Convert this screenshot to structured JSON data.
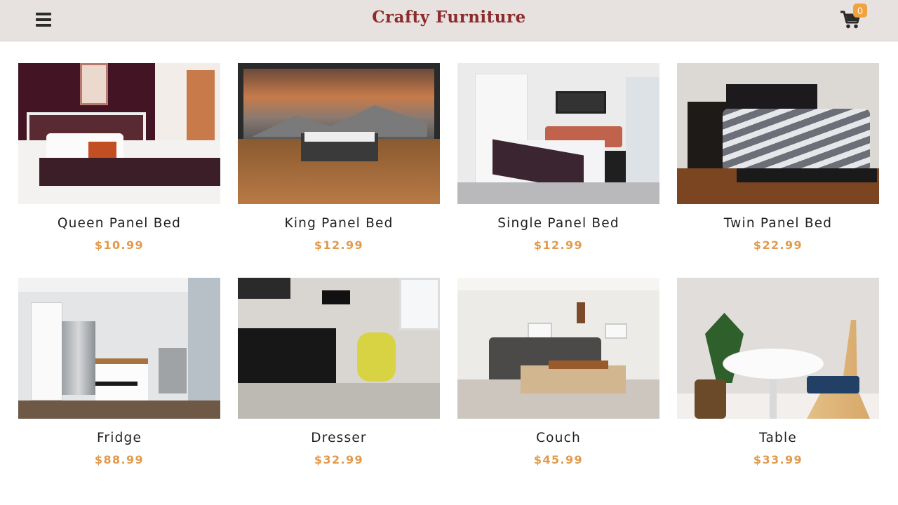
{
  "navbar": {
    "brand": "Crafty Furniture",
    "menu_icon": "hamburger-menu-icon",
    "cart_icon": "shopping-cart-icon",
    "cart_count": "0"
  },
  "colors": {
    "navbar_bg": "#e7e2df",
    "brand": "#8b2b2b",
    "price": "#e29a4c",
    "badge": "#f0a23d"
  },
  "products": [
    {
      "name": "Queen Panel Bed",
      "price": "$10.99"
    },
    {
      "name": "King Panel Bed",
      "price": "$12.99"
    },
    {
      "name": "Single Panel Bed",
      "price": "$12.99"
    },
    {
      "name": "Twin Panel Bed",
      "price": "$22.99"
    },
    {
      "name": "Fridge",
      "price": "$88.99"
    },
    {
      "name": "Dresser",
      "price": "$32.99"
    },
    {
      "name": "Couch",
      "price": "$45.99"
    },
    {
      "name": "Table",
      "price": "$33.99"
    }
  ]
}
